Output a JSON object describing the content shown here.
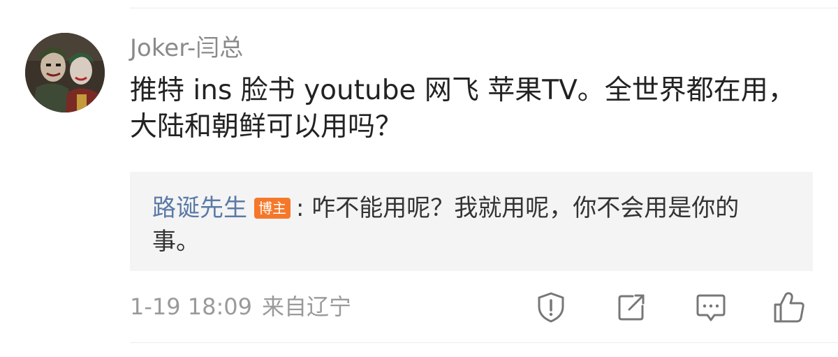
{
  "comment": {
    "username": "Joker-闫总",
    "text": "推特 ins 脸书 youtube 网飞 苹果TV。全世界都在用，大陆和朝鲜可以用吗？"
  },
  "reply": {
    "author": "路诞先生",
    "badge": "博主",
    "separator": ":",
    "text": "咋不能用呢？我就用呢，你不会用是你的事。"
  },
  "meta": {
    "timestamp": "1-19 18:09",
    "source": "来自辽宁"
  },
  "actions": [
    {
      "icon": "report-shield-icon"
    },
    {
      "icon": "share-icon"
    },
    {
      "icon": "comment-icon"
    },
    {
      "icon": "like-thumb-icon"
    }
  ],
  "colors": {
    "username": "#8a8a8a",
    "text": "#222222",
    "reply_author": "#5b7aa7",
    "badge": "#f5782a",
    "reply_bg": "#f4f4f4",
    "meta": "#9a9a9a",
    "icon": "#777777"
  }
}
